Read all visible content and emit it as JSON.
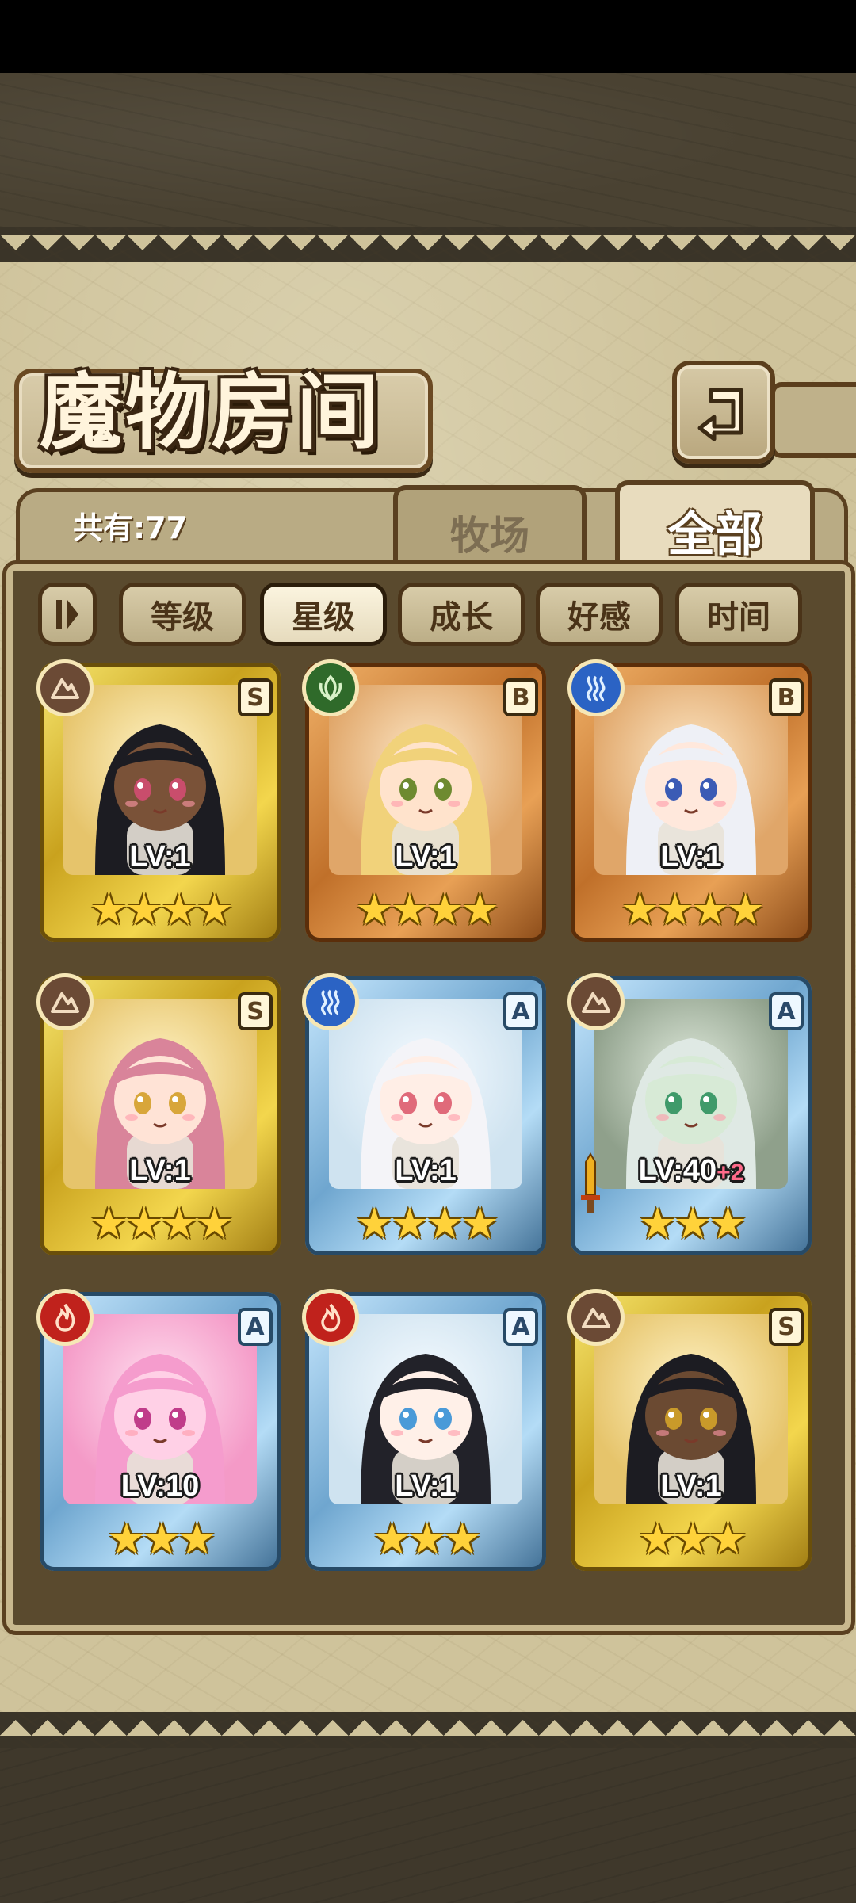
{
  "title": "魔物房间",
  "count_label": "共有:77",
  "tabs": [
    {
      "label": "牧场",
      "active": false
    },
    {
      "label": "全部",
      "active": true
    }
  ],
  "sort_buttons": [
    {
      "label": "等级",
      "active": false
    },
    {
      "label": "星级",
      "active": true
    },
    {
      "label": "成长",
      "active": false
    },
    {
      "label": "好感",
      "active": false
    },
    {
      "label": "时间",
      "active": false
    }
  ],
  "cards": [
    {
      "rank": "S",
      "element": "earth",
      "frame": "gold",
      "level": "LV:1",
      "bonus": "",
      "stars": 4
    },
    {
      "rank": "B",
      "element": "wood",
      "frame": "orange",
      "level": "LV:1",
      "bonus": "",
      "stars": 4
    },
    {
      "rank": "B",
      "element": "water",
      "frame": "orange",
      "level": "LV:1",
      "bonus": "",
      "stars": 4
    },
    {
      "rank": "S",
      "element": "earth",
      "frame": "gold",
      "level": "LV:1",
      "bonus": "",
      "stars": 4
    },
    {
      "rank": "A",
      "element": "water",
      "frame": "blue",
      "level": "LV:1",
      "bonus": "",
      "stars": 4
    },
    {
      "rank": "A",
      "element": "earth",
      "frame": "blue",
      "level": "LV:40",
      "bonus": "+2",
      "stars": 3
    },
    {
      "rank": "A",
      "element": "fire",
      "frame": "blue",
      "level": "LV:10",
      "bonus": "",
      "stars": 3
    },
    {
      "rank": "A",
      "element": "fire",
      "frame": "blue",
      "level": "LV:1",
      "bonus": "",
      "stars": 3
    },
    {
      "rank": "S",
      "element": "earth",
      "frame": "gold",
      "level": "LV:1",
      "bonus": "",
      "stars": 3
    }
  ],
  "colors": {
    "gold_frame": "#e2c23a",
    "orange_frame": "#d4843c",
    "blue_frame": "#8dc0e4",
    "star": "#ffd23a",
    "parchment": "#cfc39b",
    "panel": "#5a4a2e"
  }
}
